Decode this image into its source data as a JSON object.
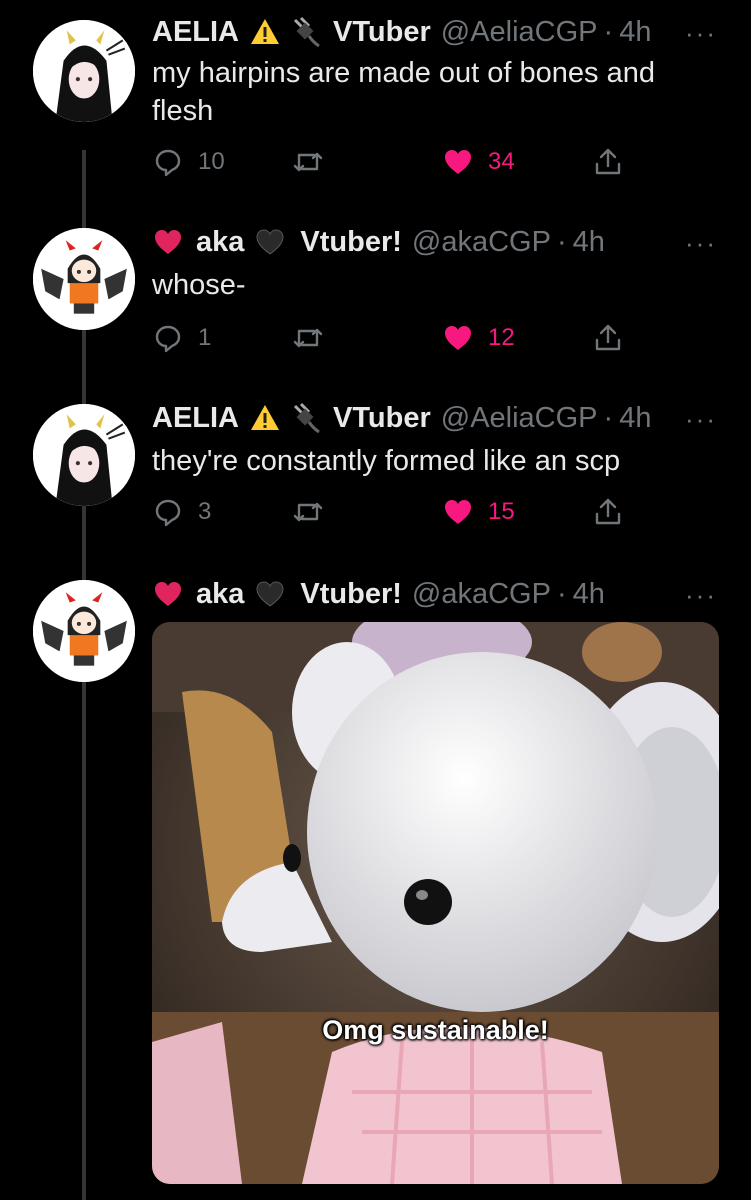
{
  "tweets": [
    {
      "name": "AELIA",
      "handle": "@AeliaCGP",
      "time": "4h",
      "text": "my hairpins are made out of bones and flesh",
      "replies": "10",
      "likes": "34",
      "icons": [
        "warning-icon",
        "electric-plug-icon"
      ]
    },
    {
      "name": "aka",
      "handle": "@akaCGP",
      "time": "4h",
      "text": "whose-",
      "replies": "1",
      "likes": "12",
      "display_suffix": "Vtuber!",
      "icons": [
        "red-heart-icon",
        "black-heart-icon"
      ]
    },
    {
      "name": "AELIA",
      "handle": "@AeliaCGP",
      "time": "4h",
      "text": "they're constantly formed like an scp",
      "replies": "3",
      "likes": "15",
      "icons": [
        "warning-icon",
        "electric-plug-icon"
      ]
    },
    {
      "name": "aka",
      "handle": "@akaCGP",
      "time": "4h",
      "display_suffix": "Vtuber!",
      "media_caption": "Omg sustainable!",
      "icons": [
        "red-heart-icon",
        "black-heart-icon"
      ]
    }
  ],
  "aelia_suffix": "VTuber",
  "dot": "·",
  "more": "···",
  "colors": {
    "background": "#000000",
    "text": "#e7e9ea",
    "secondary": "#71767b",
    "like": "#f91880",
    "thread_line": "#333639"
  }
}
